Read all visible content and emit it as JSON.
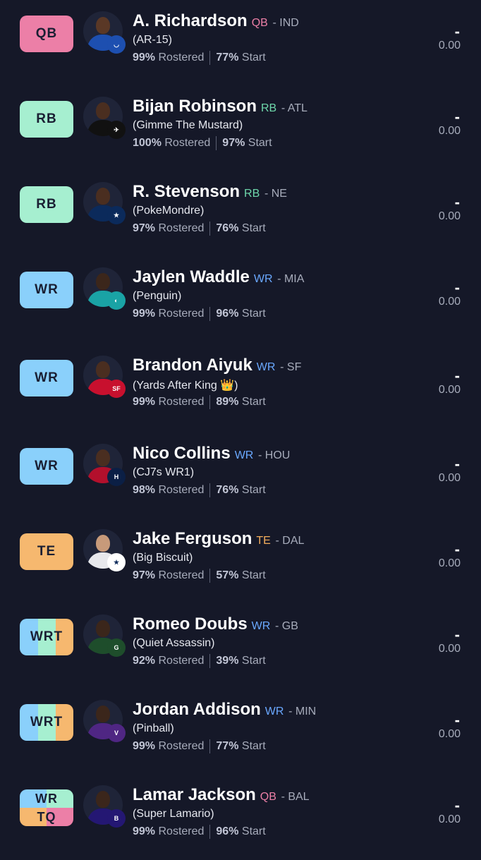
{
  "colors": {
    "QB": "#ec7fa7",
    "RB": "#a6efd0",
    "WR": "#8ad0fb",
    "TE": "#f6b86f",
    "pos_QB": "#ec7fa7",
    "pos_RB": "#6ed7ab",
    "pos_WR": "#6aa8ff",
    "pos_TE": "#f3ad5b"
  },
  "players": [
    {
      "slot": "QB",
      "name": "A. Richardson",
      "pos": "QB",
      "team": "- IND",
      "nickname": "(AR-15)",
      "rostered_pct": "99%",
      "rostered_label": "Rostered",
      "start_pct": "77%",
      "start_label": "Start",
      "projection": "-",
      "score": "0.00",
      "team_logo_icon": "colts-logo-icon"
    },
    {
      "slot": "RB",
      "name": "Bijan Robinson",
      "pos": "RB",
      "team": "- ATL",
      "nickname": "(Gimme The Mustard)",
      "rostered_pct": "100%",
      "rostered_label": "Rostered",
      "start_pct": "97%",
      "start_label": "Start",
      "projection": "-",
      "score": "0.00",
      "team_logo_icon": "falcons-logo-icon"
    },
    {
      "slot": "RB",
      "name": "R. Stevenson",
      "pos": "RB",
      "team": "- NE",
      "nickname": "(PokeMondre)",
      "rostered_pct": "97%",
      "rostered_label": "Rostered",
      "start_pct": "76%",
      "start_label": "Start",
      "projection": "-",
      "score": "0.00",
      "team_logo_icon": "patriots-logo-icon"
    },
    {
      "slot": "WR",
      "name": "Jaylen Waddle",
      "pos": "WR",
      "team": "- MIA",
      "nickname": "(Penguin)",
      "rostered_pct": "99%",
      "rostered_label": "Rostered",
      "start_pct": "96%",
      "start_label": "Start",
      "projection": "-",
      "score": "0.00",
      "team_logo_icon": "dolphins-logo-icon"
    },
    {
      "slot": "WR",
      "name": "Brandon Aiyuk",
      "pos": "WR",
      "team": "- SF",
      "nickname": "(Yards After King 👑)",
      "rostered_pct": "99%",
      "rostered_label": "Rostered",
      "start_pct": "89%",
      "start_label": "Start",
      "projection": "-",
      "score": "0.00",
      "team_logo_icon": "49ers-logo-icon"
    },
    {
      "slot": "WR",
      "name": "Nico Collins",
      "pos": "WR",
      "team": "- HOU",
      "nickname": "(CJ7s WR1)",
      "rostered_pct": "98%",
      "rostered_label": "Rostered",
      "start_pct": "76%",
      "start_label": "Start",
      "projection": "-",
      "score": "0.00",
      "team_logo_icon": "texans-logo-icon"
    },
    {
      "slot": "TE",
      "name": "Jake Ferguson",
      "pos": "TE",
      "team": "- DAL",
      "nickname": "(Big Biscuit)",
      "rostered_pct": "97%",
      "rostered_label": "Rostered",
      "start_pct": "57%",
      "start_label": "Start",
      "projection": "-",
      "score": "0.00",
      "team_logo_icon": "cowboys-logo-icon"
    },
    {
      "slot": "WRT",
      "name": "Romeo Doubs",
      "pos": "WR",
      "team": "- GB",
      "nickname": "(Quiet Assassin)",
      "rostered_pct": "92%",
      "rostered_label": "Rostered",
      "start_pct": "39%",
      "start_label": "Start",
      "projection": "-",
      "score": "0.00",
      "team_logo_icon": "packers-logo-icon"
    },
    {
      "slot": "WRT",
      "name": "Jordan Addison",
      "pos": "WR",
      "team": "- MIN",
      "nickname": "(Pinball)",
      "rostered_pct": "99%",
      "rostered_label": "Rostered",
      "start_pct": "77%",
      "start_label": "Start",
      "projection": "-",
      "score": "0.00",
      "team_logo_icon": "vikings-logo-icon"
    },
    {
      "slot": "WRTQ",
      "slot_top": "WR",
      "slot_bottom": "TQ",
      "name": "Lamar Jackson",
      "pos": "QB",
      "team": "- BAL",
      "nickname": "(Super Lamario)",
      "rostered_pct": "99%",
      "rostered_label": "Rostered",
      "start_pct": "96%",
      "start_label": "Start",
      "projection": "-",
      "score": "0.00",
      "team_logo_icon": "ravens-logo-icon"
    }
  ]
}
